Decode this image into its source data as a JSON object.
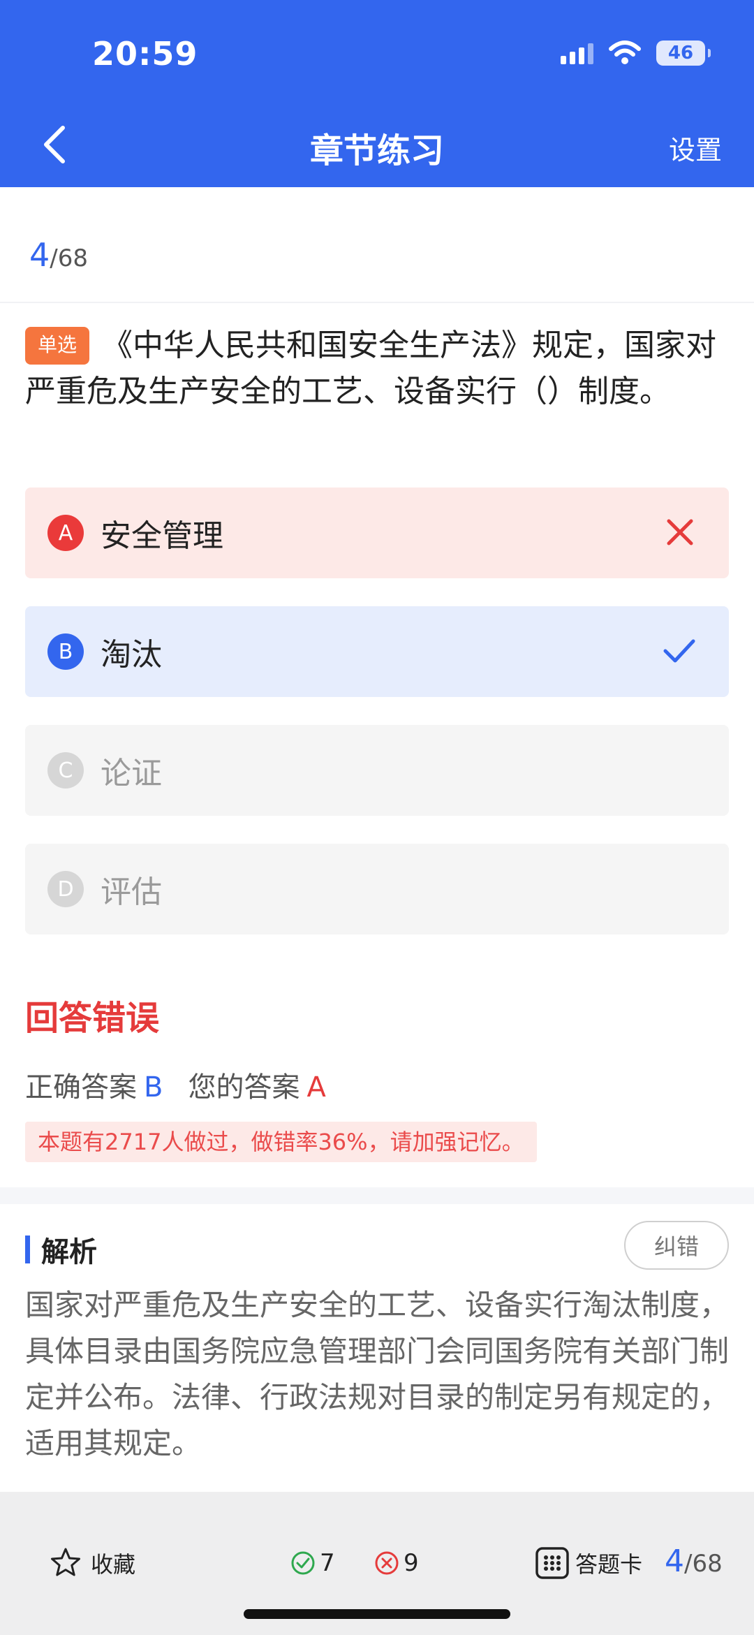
{
  "status": {
    "time": "20:59",
    "battery": "46"
  },
  "nav": {
    "title": "章节练习",
    "settings": "设置"
  },
  "progress": {
    "current": "4",
    "total": "/68"
  },
  "question": {
    "tag": "单选",
    "text": "《中华人民共和国安全生产法》规定，国家对严重危及生产安全的工艺、设备实行（）制度。"
  },
  "options": [
    {
      "letter": "A",
      "text": "安全管理",
      "state": "wrong"
    },
    {
      "letter": "B",
      "text": "淘汰",
      "state": "correct"
    },
    {
      "letter": "C",
      "text": "论证",
      "state": "normal"
    },
    {
      "letter": "D",
      "text": "评估",
      "state": "normal"
    }
  ],
  "result": {
    "title": "回答错误",
    "correct_label": "正确答案",
    "correct_value": "B",
    "your_label": "您的答案",
    "your_value": "A",
    "stats": "本题有2717人做过，做错率36%，请加强记忆。"
  },
  "analysis": {
    "title": "解析",
    "report_button": "纠错",
    "text": "国家对严重危及生产安全的工艺、设备实行淘汰制度，具体目录由国务院应急管理部门会同国务院有关部门制定并公布。法律、行政法规对目录的制定另有规定的，适用其规定。"
  },
  "bottom": {
    "favorite": "收藏",
    "right_count": "7",
    "wrong_count": "9",
    "answer_card": "答题卡",
    "progress_current": "4",
    "progress_total": "/68"
  },
  "colors": {
    "primary": "#3366ee",
    "error": "#e53b3b",
    "tag": "#f5753e"
  },
  "icons": [
    "back-arrow-icon",
    "signal-icon",
    "wifi-icon",
    "battery-icon",
    "cross-icon",
    "check-icon",
    "star-icon",
    "check-circle-icon",
    "cross-circle-icon",
    "grid-icon"
  ]
}
